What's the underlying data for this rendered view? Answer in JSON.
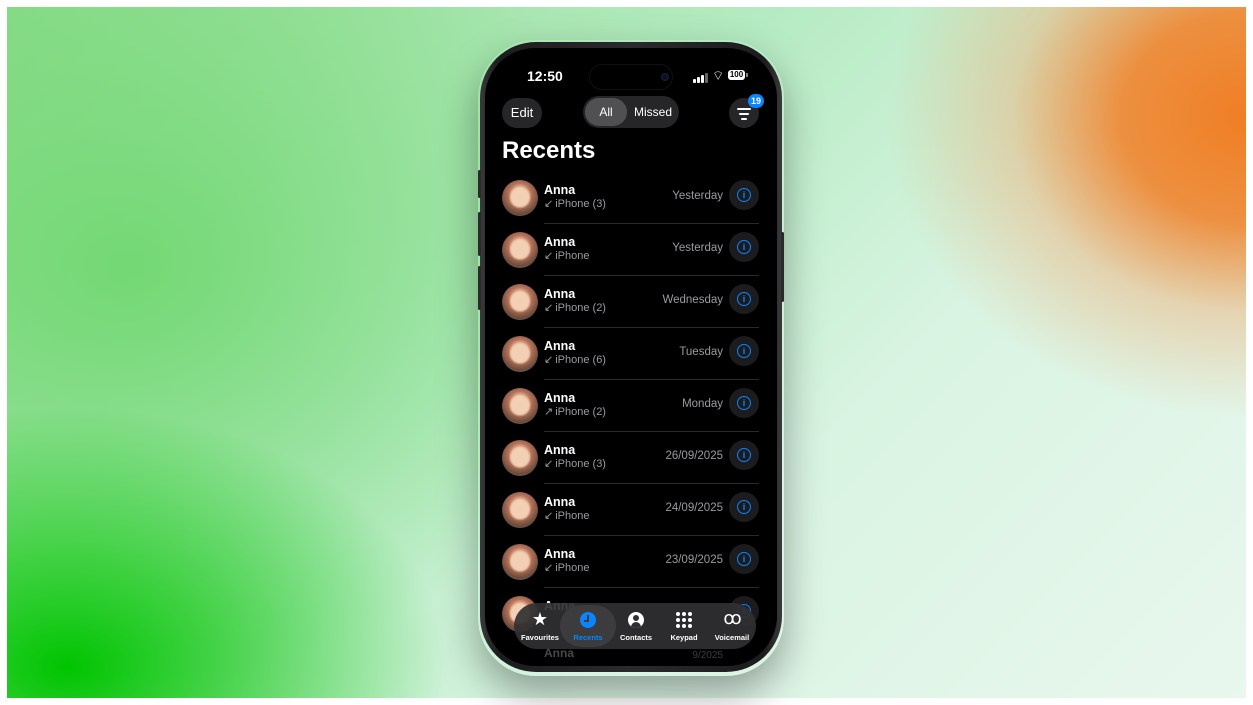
{
  "status_bar": {
    "time": "12:50",
    "battery": "100"
  },
  "nav": {
    "edit_label": "Edit",
    "segments": [
      "All",
      "Missed"
    ],
    "selected_segment": "All",
    "filter_badge": "19"
  },
  "title": "Recents",
  "calls": [
    {
      "name": "Anna",
      "arrow": "↙",
      "detail": "iPhone (3)",
      "date": "Yesterday"
    },
    {
      "name": "Anna",
      "arrow": "↙",
      "detail": "iPhone",
      "date": "Yesterday"
    },
    {
      "name": "Anna",
      "arrow": "↙",
      "detail": "iPhone (2)",
      "date": "Wednesday"
    },
    {
      "name": "Anna",
      "arrow": "↙",
      "detail": "iPhone (6)",
      "date": "Tuesday"
    },
    {
      "name": "Anna",
      "arrow": "↗",
      "detail": "iPhone (2)",
      "date": "Monday"
    },
    {
      "name": "Anna",
      "arrow": "↙",
      "detail": "iPhone (3)",
      "date": "26/09/2025"
    },
    {
      "name": "Anna",
      "arrow": "↙",
      "detail": "iPhone",
      "date": "24/09/2025"
    },
    {
      "name": "Anna",
      "arrow": "↙",
      "detail": "iPhone",
      "date": "23/09/2025"
    },
    {
      "name": "Anna",
      "arrow": "",
      "detail": "",
      "date": ""
    }
  ],
  "peek_row": {
    "name": "Anna",
    "date": "9/2025"
  },
  "tabbar": {
    "active": "Recents",
    "tabs": [
      {
        "label": "Favourites",
        "icon": "star-icon"
      },
      {
        "label": "Recents",
        "icon": "clock-icon"
      },
      {
        "label": "Contacts",
        "icon": "person-circle-icon"
      },
      {
        "label": "Keypad",
        "icon": "keypad-icon"
      },
      {
        "label": "Voicemail",
        "icon": "voicemail-icon"
      }
    ]
  },
  "colors": {
    "accent": "#0a84ff",
    "screen_bg": "#000000",
    "bg_orange": "#f07e24",
    "bg_green": "#00c400"
  }
}
